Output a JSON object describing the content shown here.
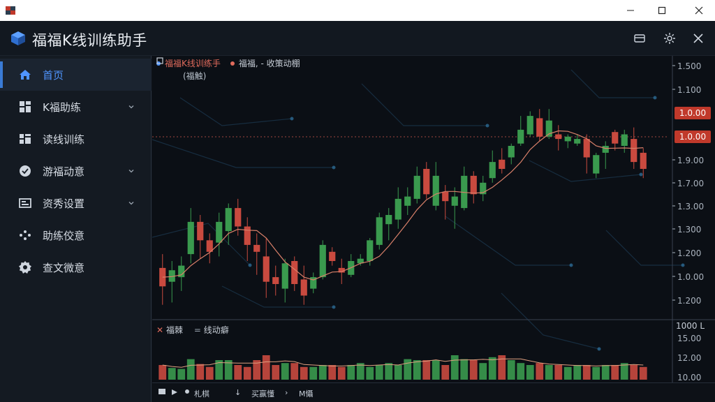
{
  "window": {
    "min_icon": "minimize-icon",
    "max_icon": "maximize-icon",
    "close_icon": "close-icon"
  },
  "header": {
    "title": "福福K线训练助手",
    "buttons": [
      "card-icon",
      "settings-icon",
      "close-icon"
    ]
  },
  "sidebar": {
    "items": [
      {
        "label": "首页",
        "icon": "home-icon",
        "active": true,
        "has_chevron": false
      },
      {
        "label": "K福助练",
        "icon": "grid-icon",
        "active": false,
        "has_chevron": true
      },
      {
        "label": "读线训练",
        "icon": "apps-icon",
        "active": false,
        "has_chevron": false
      },
      {
        "label": "游福动意",
        "icon": "check-circle-icon",
        "active": false,
        "has_chevron": true
      },
      {
        "label": "资秀设置",
        "icon": "panel-icon",
        "active": false,
        "has_chevron": true
      },
      {
        "label": "助练佼意",
        "icon": "dots-icon",
        "active": false,
        "has_chevron": false
      },
      {
        "label": "查文微意",
        "icon": "gear-icon",
        "active": false,
        "has_chevron": false
      }
    ]
  },
  "chart": {
    "legend_main": "福福K线训练手",
    "legend_icon": "square-icon",
    "legend_secondary": "福福, - 收策动棚",
    "sub_legend": "(福触)",
    "price_tag_1": "1.0.00",
    "price_tag_2": "1.0.00",
    "volume_legend_1": "福棘",
    "volume_legend_2": "线动癖",
    "volume_axis_header": "1000 L",
    "bottom_bar": [
      "札棋",
      "买赢懂",
      "M懾"
    ],
    "colors": {
      "up": "#3a9a4e",
      "down": "#c94a3f",
      "ma": "#d9806a",
      "accent": "#4f95ff"
    }
  },
  "chart_data": {
    "type": "candlestick",
    "price_axis_ticks": [
      "1.500",
      "1.100",
      "1.0.00",
      "1.0.00",
      "1.9.00",
      "1.7.00",
      "1.3.00",
      "1.300",
      "1.200",
      "1.0.00",
      "1.200"
    ],
    "volume_axis_ticks": [
      "15.00",
      "12.00",
      "10.00"
    ],
    "candles_open_close_high_low_normalized": [
      [
        0.17,
        0.09,
        0.23,
        0.01,
        0
      ],
      [
        0.11,
        0.16,
        0.2,
        0.02,
        1
      ],
      [
        0.13,
        0.18,
        0.22,
        0.07,
        1
      ],
      [
        0.23,
        0.37,
        0.43,
        0.19,
        1
      ],
      [
        0.37,
        0.29,
        0.4,
        0.21,
        0
      ],
      [
        0.29,
        0.24,
        0.32,
        0.19,
        0
      ],
      [
        0.28,
        0.37,
        0.41,
        0.22,
        1
      ],
      [
        0.33,
        0.43,
        0.45,
        0.27,
        1
      ],
      [
        0.43,
        0.35,
        0.47,
        0.31,
        0
      ],
      [
        0.35,
        0.27,
        0.39,
        0.2,
        0
      ],
      [
        0.27,
        0.24,
        0.32,
        0.14,
        0
      ],
      [
        0.22,
        0.11,
        0.3,
        0.04,
        0
      ],
      [
        0.1,
        0.13,
        0.18,
        0.05,
        0
      ],
      [
        0.08,
        0.19,
        0.21,
        0.02,
        1
      ],
      [
        0.2,
        0.1,
        0.22,
        0.07,
        0
      ],
      [
        0.12,
        0.05,
        0.18,
        0.01,
        0
      ],
      [
        0.08,
        0.13,
        0.15,
        0.06,
        1
      ],
      [
        0.13,
        0.27,
        0.29,
        0.12,
        1
      ],
      [
        0.24,
        0.2,
        0.26,
        0.18,
        0
      ],
      [
        0.17,
        0.15,
        0.21,
        0.1,
        0
      ],
      [
        0.14,
        0.2,
        0.23,
        0.13,
        1
      ],
      [
        0.19,
        0.21,
        0.23,
        0.18,
        1
      ],
      [
        0.2,
        0.29,
        0.3,
        0.18,
        1
      ],
      [
        0.27,
        0.39,
        0.41,
        0.25,
        1
      ],
      [
        0.36,
        0.4,
        0.43,
        0.29,
        1
      ],
      [
        0.38,
        0.47,
        0.52,
        0.34,
        1
      ],
      [
        0.44,
        0.48,
        0.52,
        0.4,
        1
      ],
      [
        0.47,
        0.57,
        0.61,
        0.45,
        1
      ],
      [
        0.6,
        0.49,
        0.63,
        0.47,
        0
      ],
      [
        0.44,
        0.57,
        0.63,
        0.42,
        1
      ],
      [
        0.5,
        0.46,
        0.53,
        0.38,
        0
      ],
      [
        0.44,
        0.48,
        0.52,
        0.34,
        1
      ],
      [
        0.43,
        0.57,
        0.61,
        0.42,
        1
      ],
      [
        0.57,
        0.49,
        0.59,
        0.45,
        0
      ],
      [
        0.49,
        0.54,
        0.57,
        0.46,
        1
      ],
      [
        0.56,
        0.63,
        0.68,
        0.54,
        1
      ],
      [
        0.64,
        0.6,
        0.69,
        0.58,
        0
      ],
      [
        0.65,
        0.7,
        0.71,
        0.62,
        1
      ],
      [
        0.71,
        0.77,
        0.83,
        0.7,
        1
      ],
      [
        0.75,
        0.83,
        0.85,
        0.74,
        1
      ],
      [
        0.82,
        0.74,
        0.86,
        0.72,
        0
      ],
      [
        0.74,
        0.81,
        0.86,
        0.73,
        1
      ],
      [
        0.75,
        0.73,
        0.79,
        0.68,
        0
      ],
      [
        0.72,
        0.74,
        0.75,
        0.69,
        1
      ],
      [
        0.71,
        0.73,
        0.75,
        0.7,
        1
      ],
      [
        0.73,
        0.65,
        0.75,
        0.58,
        0
      ],
      [
        0.58,
        0.66,
        0.67,
        0.56,
        1
      ],
      [
        0.67,
        0.7,
        0.72,
        0.6,
        1
      ],
      [
        0.76,
        0.71,
        0.77,
        0.68,
        0
      ],
      [
        0.7,
        0.75,
        0.77,
        0.67,
        1
      ],
      [
        0.73,
        0.63,
        0.78,
        0.6,
        0
      ],
      [
        0.67,
        0.6,
        0.69,
        0.56,
        0
      ]
    ],
    "volumes_normalized": [
      0.3,
      0.24,
      0.22,
      0.42,
      0.32,
      0.26,
      0.4,
      0.4,
      0.3,
      0.26,
      0.4,
      0.5,
      0.3,
      0.34,
      0.34,
      0.26,
      0.26,
      0.3,
      0.3,
      0.26,
      0.3,
      0.34,
      0.26,
      0.3,
      0.34,
      0.3,
      0.42,
      0.4,
      0.4,
      0.4,
      0.3,
      0.5,
      0.42,
      0.4,
      0.34,
      0.46,
      0.5,
      0.4,
      0.34,
      0.3,
      0.34,
      0.3,
      0.3,
      0.26,
      0.3,
      0.3,
      0.26,
      0.3,
      0.3,
      0.34,
      0.3,
      0.26
    ]
  }
}
